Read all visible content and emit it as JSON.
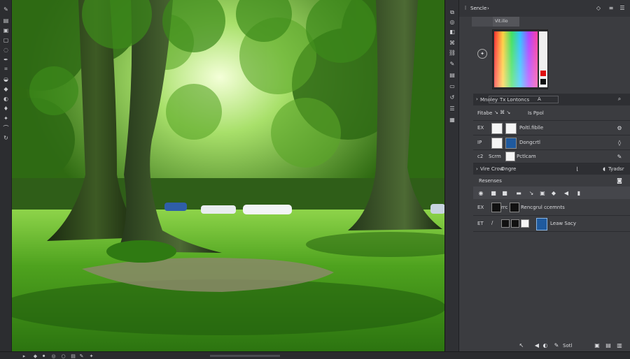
{
  "panel": {
    "tab_label": "Sencle",
    "tab_arrow": "›",
    "color_tab": "Vit.ilio"
  },
  "properties": {
    "header_a": "Mnoley",
    "header_b": "Tx Lontoncs",
    "header_tool": "A",
    "subheader": "Fitabe",
    "subheader_right": "Is Ppol",
    "rows": [
      {
        "id": "EX",
        "label": "Poltl.fiblle"
      },
      {
        "id": "IP",
        "label": "Dongcrtl"
      },
      {
        "id": "c2",
        "label": "Scrm",
        "label2": "Pctlcam"
      }
    ]
  },
  "layers_section": {
    "title": "Vire Crow",
    "title_b": "Dngre",
    "right_label": "Tyadsr",
    "subheader": "Resenses",
    "rows": [
      {
        "id": "EX",
        "label": "Rencgrul ccemnts",
        "prefix": "rrc"
      },
      {
        "id": "ET",
        "label": "Leaw Sacy"
      }
    ]
  },
  "footer": {
    "label": "Sotl"
  },
  "colors": {
    "panel_bg": "#3b3c40",
    "toolbar_bg": "#2c2d30",
    "accent_blue": "#1f5a9e",
    "canvas_green": "#3f8a1c"
  },
  "icons": {
    "left_toolbar": [
      "brush-icon",
      "layers-icon",
      "square-icon",
      "rect-select-icon",
      "lasso-icon",
      "pen-icon",
      "crop-icon",
      "bucket-icon",
      "eraser-icon",
      "dodge-icon",
      "drop-icon",
      "clone-icon",
      "smudge-icon",
      "hand-icon",
      "zoom-icon"
    ],
    "right_strip": [
      "history-icon",
      "adjust-icon",
      "color-icon",
      "paths-icon",
      "chain-icon",
      "brush-preset-icon",
      "layers-icon",
      "doc-icon",
      "rotate-icon",
      "stack-icon",
      "text-icon"
    ]
  }
}
